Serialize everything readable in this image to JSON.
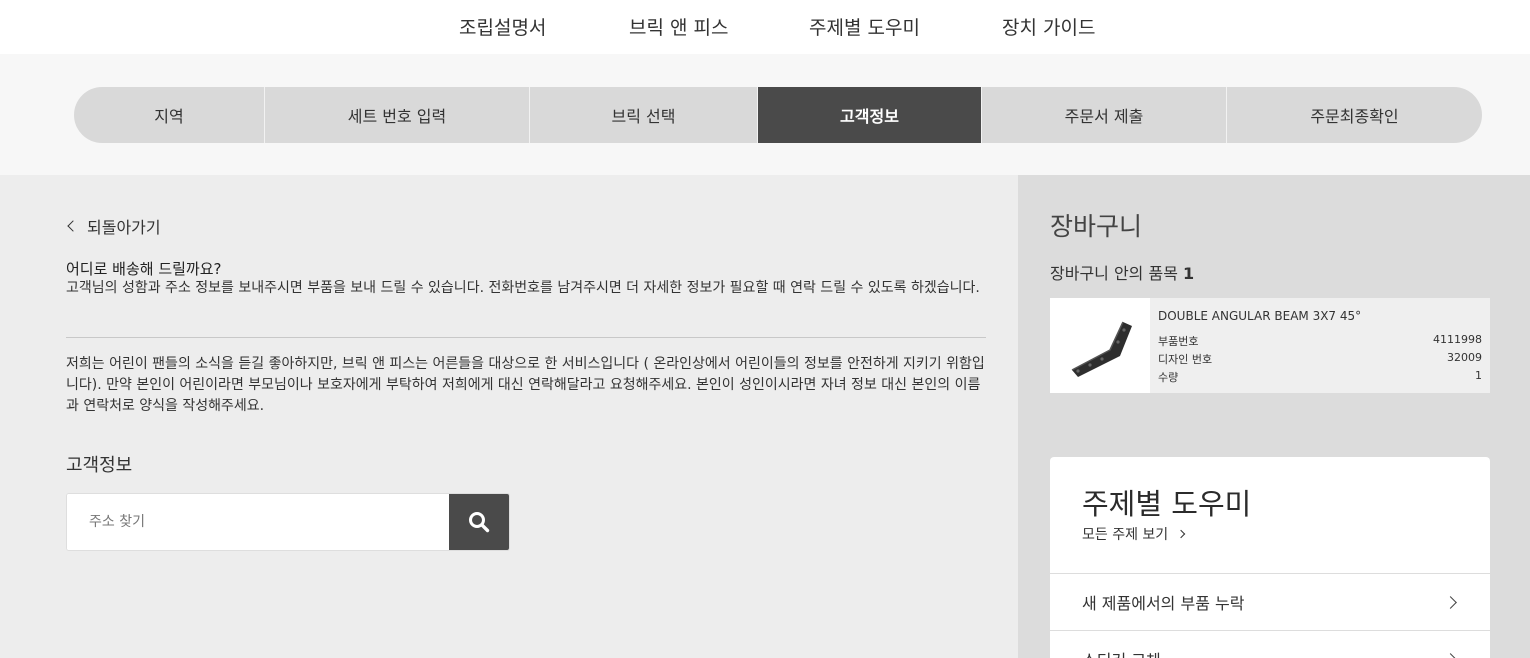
{
  "nav": {
    "items": [
      "조립설명서",
      "브릭 앤 피스",
      "주제별 도우미",
      "장치 가이드"
    ]
  },
  "stepper": {
    "steps": [
      "지역",
      "세트 번호 입력",
      "브릭 선택",
      "고객정보",
      "주문서 제출",
      "주문최종확인"
    ],
    "active": "고객정보"
  },
  "main": {
    "back_label": "되돌아가기",
    "question_title": "어디로 배송해 드릴까요?",
    "question_text": "고객님의 성함과 주소 정보를 보내주시면 부품을 보내 드릴 수 있습니다. 전화번호를 남겨주시면 더 자세한 정보가 필요할 때 연락 드릴 수 있도록 하겠습니다.",
    "notice_text": "저희는 어린이 팬들의 소식을 듣길 좋아하지만, 브릭 앤 피스는 어른들을 대상으로 한 서비스입니다 ( 온라인상에서 어린이들의 정보를 안전하게 지키기 위함입니다). 만약 본인이 어린이라면 부모님이나 보호자에게 부탁하여 저희에게 대신 연락해달라고 요청해주세요. 본인이 성인이시라면 자녀 정보 대신 본인의 이름과 연락처로 양식을 작성해주세요.",
    "section_title": "고객정보",
    "search_placeholder": "주소 찾기"
  },
  "cart": {
    "title": "장바구니",
    "count_label": "장바구니 안의 품목",
    "count": "1",
    "item": {
      "name": "DOUBLE ANGULAR BEAM 3X7 45°",
      "part_label": "부품번호",
      "part_value": "4111998",
      "design_label": "디자인 번호",
      "design_value": "32009",
      "qty_label": "수량",
      "qty_value": "1"
    }
  },
  "help": {
    "title": "주제별 도우미",
    "all_label": "모든 주제 보기",
    "rows": [
      "새 제품에서의 부품 누락",
      "스티커 교체"
    ]
  },
  "colors": {
    "active_step": "#4a4a4a",
    "main_bg": "#ededed",
    "sidebar_bg": "#dcdcdc"
  }
}
